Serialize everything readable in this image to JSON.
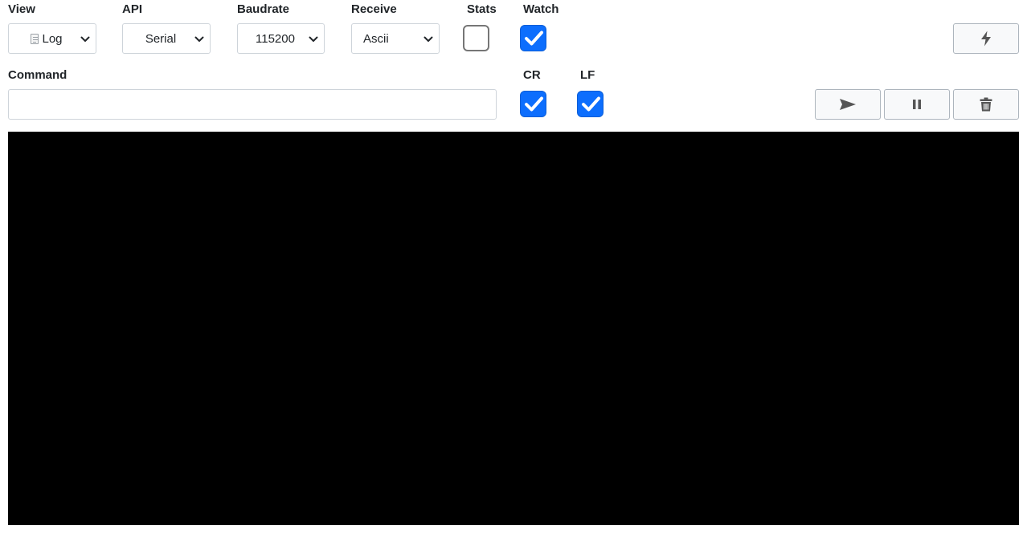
{
  "labels": {
    "view": "View",
    "api": "API",
    "baudrate": "Baudrate",
    "receive": "Receive",
    "stats": "Stats",
    "watch": "Watch",
    "command": "Command",
    "cr": "CR",
    "lf": "LF"
  },
  "selects": {
    "view": {
      "value": "Log",
      "icon": "document-icon"
    },
    "api": {
      "value": "Serial"
    },
    "baudrate": {
      "value": "115200"
    },
    "receive": {
      "value": "Ascii"
    }
  },
  "checkboxes": {
    "stats": false,
    "watch": true,
    "cr": true,
    "lf": true
  },
  "command": {
    "value": "",
    "placeholder": ""
  },
  "buttons": {
    "connect": {
      "icon": "lightning-bolt-icon"
    },
    "send": {
      "icon": "send-icon"
    },
    "pause": {
      "icon": "pause-icon"
    },
    "clear": {
      "icon": "trash-icon"
    }
  },
  "terminal": {
    "content": ""
  },
  "colors": {
    "accent": "#0d6efd",
    "terminal_bg": "#000000",
    "icon": "#555555"
  }
}
